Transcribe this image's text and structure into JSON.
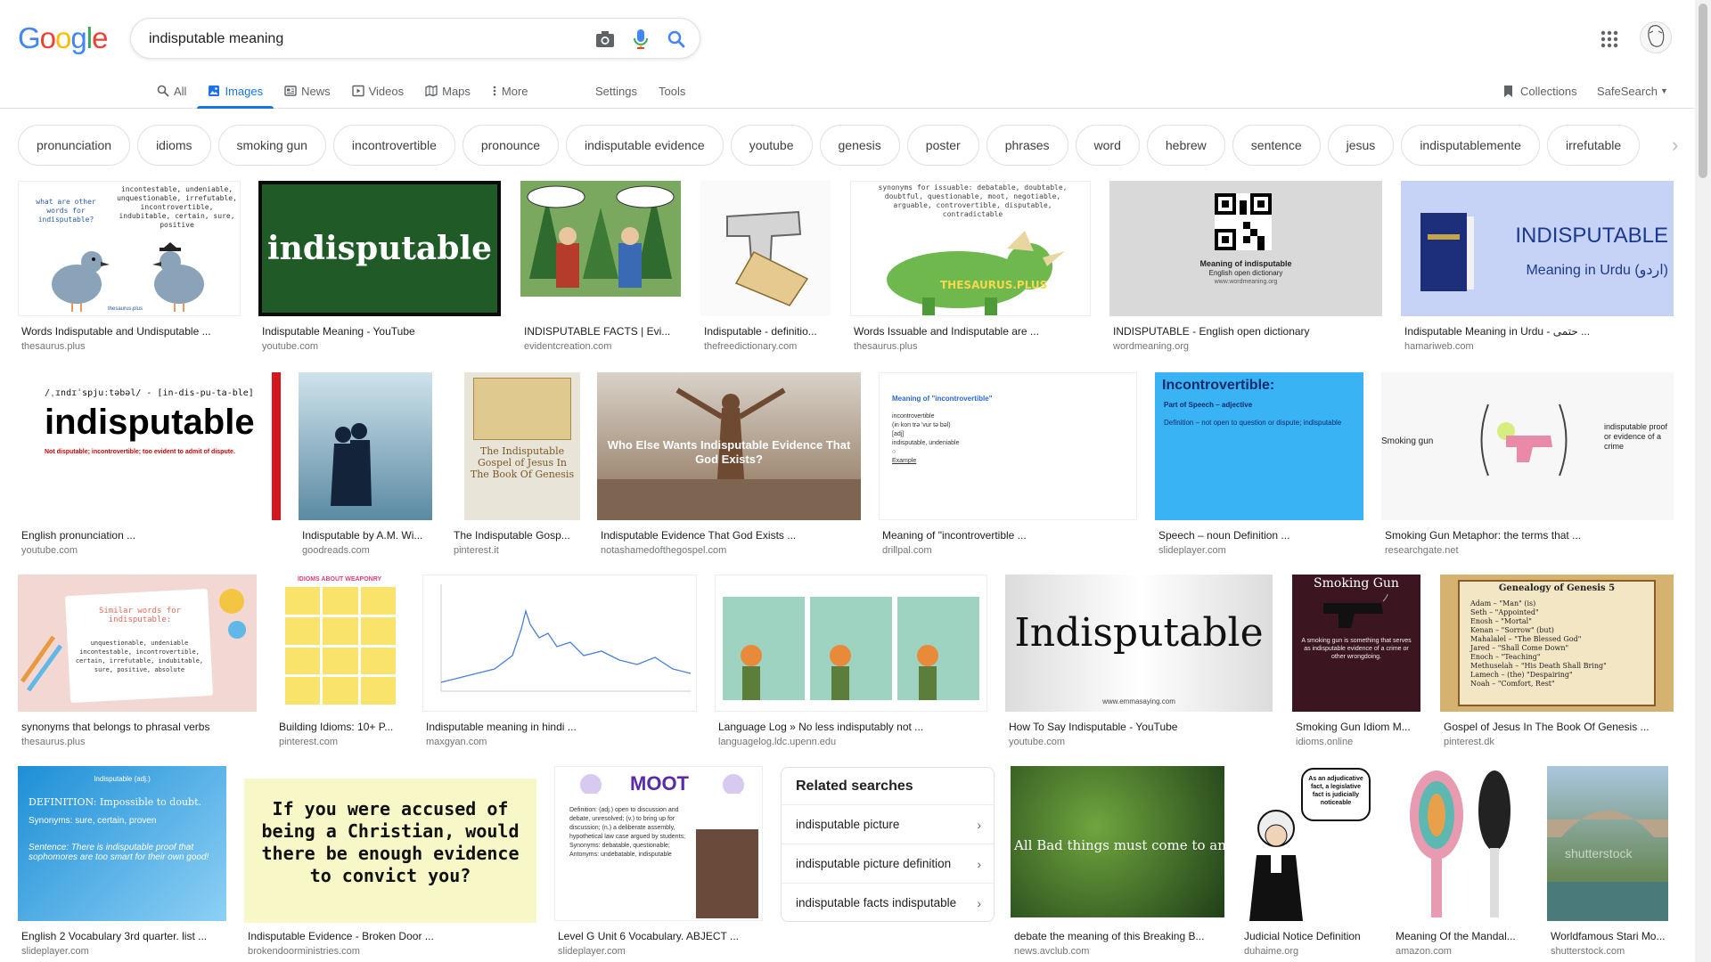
{
  "search": {
    "query": "indisputable meaning"
  },
  "logo": {
    "letters": [
      "G",
      "o",
      "o",
      "g",
      "l",
      "e"
    ],
    "colors": [
      "#4285f4",
      "#ea4335",
      "#fbbc05",
      "#4285f4",
      "#34a853",
      "#ea4335"
    ]
  },
  "tabs": [
    {
      "label": "All",
      "icon": "search-icon"
    },
    {
      "label": "Images",
      "icon": "image-icon",
      "active": true
    },
    {
      "label": "News",
      "icon": "news-icon"
    },
    {
      "label": "Videos",
      "icon": "video-icon"
    },
    {
      "label": "Maps",
      "icon": "map-icon"
    },
    {
      "label": "More",
      "icon": "more-icon"
    }
  ],
  "tools": {
    "settings": "Settings",
    "tools": "Tools"
  },
  "right_tools": {
    "collections": "Collections",
    "safesearch": "SafeSearch"
  },
  "chips": [
    "pronunciation",
    "idioms",
    "smoking gun",
    "incontrovertible",
    "pronounce",
    "indisputable evidence",
    "youtube",
    "genesis",
    "poster",
    "phrases",
    "word",
    "hebrew",
    "sentence",
    "jesus",
    "indisputablemente",
    "irrefutable"
  ],
  "images": [
    {
      "caption": "Words Indisputable and Undisputable ...",
      "source": "thesaurus.plus"
    },
    {
      "caption": "Indisputable Meaning - YouTube",
      "source": "youtube.com"
    },
    {
      "caption": "INDISPUTABLE FACTS | Evi...",
      "source": "evidentcreation.com"
    },
    {
      "caption": "Indisputable - definitio...",
      "source": "thefreedictionary.com"
    },
    {
      "caption": "Words Issuable and Indisputable are ...",
      "source": "thesaurus.plus"
    },
    {
      "caption": "INDISPUTABLE - English open dictionary",
      "source": "wordmeaning.org"
    },
    {
      "caption": "Indisputable Meaning in Urdu - حتمی ...",
      "source": "hamariweb.com"
    },
    {
      "caption": "English pronunciation ...",
      "source": "youtube.com"
    },
    {
      "caption": "Indisputable by A.M. Wi...",
      "source": "goodreads.com"
    },
    {
      "caption": "The Indisputable Gosp...",
      "source": "pinterest.it"
    },
    {
      "caption": "Indisputable Evidence That God Exists ...",
      "source": "notashamedofthegospel.com"
    },
    {
      "caption": "Meaning of \"incontrovertible ...",
      "source": "drillpal.com"
    },
    {
      "caption": "Speech – noun Definition ...",
      "source": "slideplayer.com"
    },
    {
      "caption": "Smoking Gun Metaphor: the terms that ...",
      "source": "researchgate.net"
    },
    {
      "caption": "synonyms that belongs to phrasal verbs",
      "source": "thesaurus.plus"
    },
    {
      "caption": "Building Idioms: 10+ P...",
      "source": "pinterest.com"
    },
    {
      "caption": "Indisputable meaning in hindi ...",
      "source": "maxgyan.com"
    },
    {
      "caption": "Language Log » No less indisputably not ...",
      "source": "languagelog.ldc.upenn.edu"
    },
    {
      "caption": "How To Say Indisputable - YouTube",
      "source": "youtube.com"
    },
    {
      "caption": "Smoking Gun Idiom M...",
      "source": "idioms.online"
    },
    {
      "caption": "Gospel of Jesus In The Book Of Genesis ...",
      "source": "pinterest.dk"
    },
    {
      "caption": "English 2 Vocabulary 3rd quarter. list ...",
      "source": "slideplayer.com"
    },
    {
      "caption": "Indisputable Evidence - Broken Door ...",
      "source": "brokendoorministries.com"
    },
    {
      "caption": "Level G Unit 6 Vocabulary. ABJECT ...",
      "source": "slideplayer.com"
    },
    {
      "caption": "debate the meaning of this Breaking B...",
      "source": "news.avclub.com"
    },
    {
      "caption": "Judicial Notice Definition",
      "source": "duhaime.org"
    },
    {
      "caption": "Meaning Of the Mandal...",
      "source": "amazon.com"
    },
    {
      "caption": "Worldfamous Stari Mo...",
      "source": "shutterstock.com"
    }
  ],
  "thumb_text": {
    "pigeons_q": "what are other words for indisputable?",
    "pigeons_syn": "incontestable, undeniable, unquestionable, irrefutable, incontrovertible, indubitable, certain, sure, positive",
    "pigeons_logo": "thesaurus.plus",
    "green_word": "indisputable",
    "qr_title": "Meaning of indisputable",
    "qr_sub": "English open dictionary",
    "qr_url": "www.wordmeaning.org",
    "urdu_title": "INDISPUTABLE",
    "urdu_sub": "Meaning in Urdu (اردو)",
    "pron_ipa": "/ˌɪndɪˈspjuːtəbəl/ - [in-dis-pu-ta-ble]",
    "pron_word": "indisputable",
    "pron_def": "Not disputable; incontrovertible; too evident to admit of dispute.",
    "gospel_title": "The Indisputable Gospel of Jesus In The Book Of Genesis",
    "evidence_title": "Who Else Wants Indisputable Evidence That God Exists?",
    "incontro_head": "Meaning of \"incontrovertible\"",
    "speech_head": "Incontrovertible:",
    "speech_pos": "Part of Speech – adjective",
    "speech_def": "Definition – not open to question or dispute; indisputable",
    "smoking_label": "Smoking gun",
    "smoking_right": "indisputable proof or evidence of a crime",
    "phrasal_title": "Similar words for indisputable:",
    "phrasal_words": "unquestionable, undeniable incontestable, incontrovertible, certain, irrefutable, indubitable, sure, positive, absolute",
    "idioms_title": "IDIOMS ABOUT WEAPONRY",
    "say_word": "Indisputable",
    "say_url": "www.emmasaying.com",
    "gun_title": "Smoking Gun",
    "gun_desc": "A smoking gun is something that serves as indisputable evidence of a crime or other wrongdoing.",
    "genesis_title": "Genealogy of Genesis 5",
    "eng2_head": "Indisputable (adj.)",
    "eng2_def": "DEFINITION: Impossible to doubt.",
    "eng2_syn": "Synonyms: sure, certain, proven",
    "eng2_sent": "Sentence: There is indisputable proof that sophomores are too smart for their own good!",
    "christian": "If you were accused of being a Christian, would there be enough evidence to convict you?",
    "moot_title": "MOOT",
    "moot_def": "Definition: (adj.) open to discussion and debate, unresolved; (v.) to bring up for discussion; (n.) a deliberate assembly, hypothetical law case argued by students; Synonyms: debatable, questionable; Antonyms: undebatable, indisputable",
    "breaking": "All Bad things must come to an",
    "judge_bubble": "As an adjudicative fact, a legislative fact is judicially noticeable",
    "stari_wm": "shutterstock"
  },
  "related": {
    "title": "Related searches",
    "items": [
      "indisputable picture",
      "indisputable picture definition",
      "indisputable facts indisputable"
    ]
  }
}
